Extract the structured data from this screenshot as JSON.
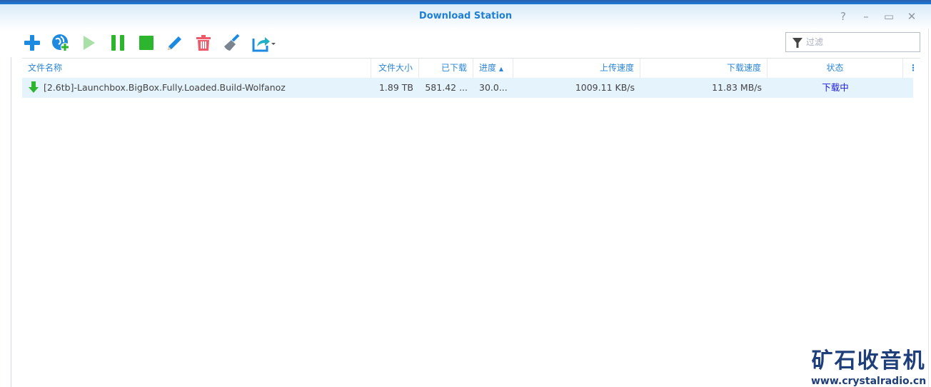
{
  "window": {
    "title": "Download Station",
    "help": "?",
    "minimize": "–",
    "maximize": "▭",
    "close": "✕"
  },
  "toolbar": {
    "icons": [
      "add-icon",
      "add-url-icon",
      "resume-icon",
      "pause-icon",
      "stop-icon",
      "edit-icon",
      "delete-icon",
      "clear-icon",
      "share-icon"
    ]
  },
  "filter": {
    "placeholder": "过滤",
    "value": ""
  },
  "table": {
    "headers": [
      "文件名称",
      "文件大小",
      "已下载",
      "进度",
      "上传速度",
      "下载速度",
      "状态"
    ],
    "sort_indicator": "▲",
    "rows": [
      {
        "name": "[2.6tb]-Launchbox.BigBox.Fully.Loaded.Build-Wolfanoz",
        "size": "1.89 TB",
        "downloaded": "581.42 ...",
        "progress": "30.0...",
        "upload": "1009.11 KB/s",
        "download": "11.83 MB/s",
        "status": "下载中"
      }
    ]
  },
  "watermark": {
    "name": "矿石收音机",
    "url": "www.crystalradio.cn"
  },
  "colors": {
    "accent": "#1f7fd6",
    "row_selected": "#e5f3fc",
    "status": "#1a1ae0"
  }
}
